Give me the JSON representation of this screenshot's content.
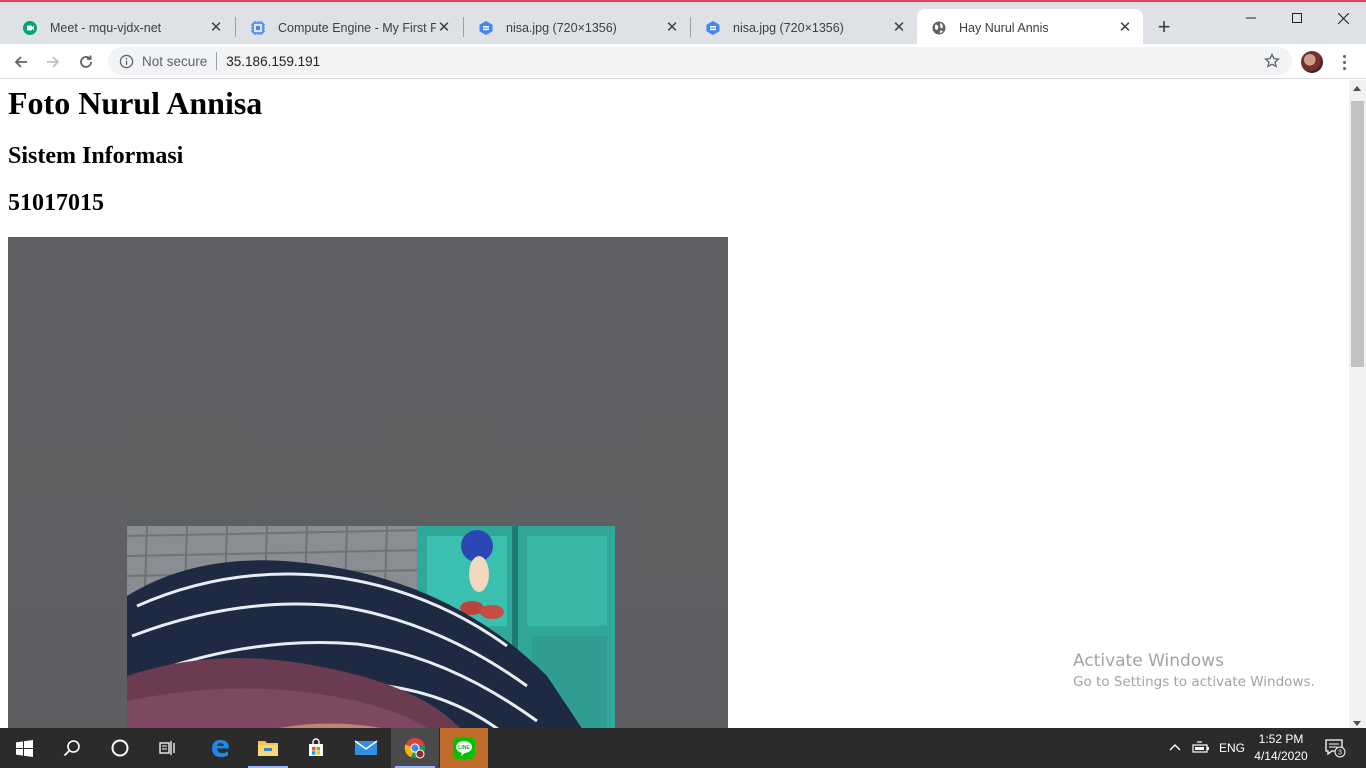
{
  "browser": {
    "tabs": [
      {
        "title": "Meet - mqu-vjdx-net",
        "icon": "google-meet-icon"
      },
      {
        "title": "Compute Engine - My First Pro",
        "icon": "compute-engine-icon"
      },
      {
        "title": "nisa.jpg (720×1356)",
        "icon": "cloud-storage-icon"
      },
      {
        "title": "nisa.jpg (720×1356)",
        "icon": "cloud-storage-icon"
      },
      {
        "title": "Hay Nurul Annis",
        "icon": "globe-icon",
        "active": true
      }
    ],
    "security_label": "Not secure",
    "url": "35.186.159.191"
  },
  "page": {
    "heading": "Foto Nurul Annisa",
    "subheading": "Sistem Informasi",
    "student_id": "51017015",
    "image_alt": "nisa.jpg"
  },
  "watermark": {
    "line1": "Activate Windows",
    "line2": "Go to Settings to activate Windows."
  },
  "taskbar": {
    "apps": [
      "start-icon",
      "search-icon",
      "cortana-icon",
      "task-view-icon",
      "edge-icon",
      "file-explorer-icon",
      "store-icon",
      "mail-icon",
      "chrome-icon",
      "line-icon"
    ],
    "language": "ENG",
    "time": "1:52 PM",
    "date": "4/14/2020",
    "notification_count": "3"
  },
  "colors": {
    "tab_strip": "#dee1e6",
    "window_accent": "#e0435a",
    "photo_frame": "#5f6063",
    "taskbar": "#2b2b2b"
  }
}
